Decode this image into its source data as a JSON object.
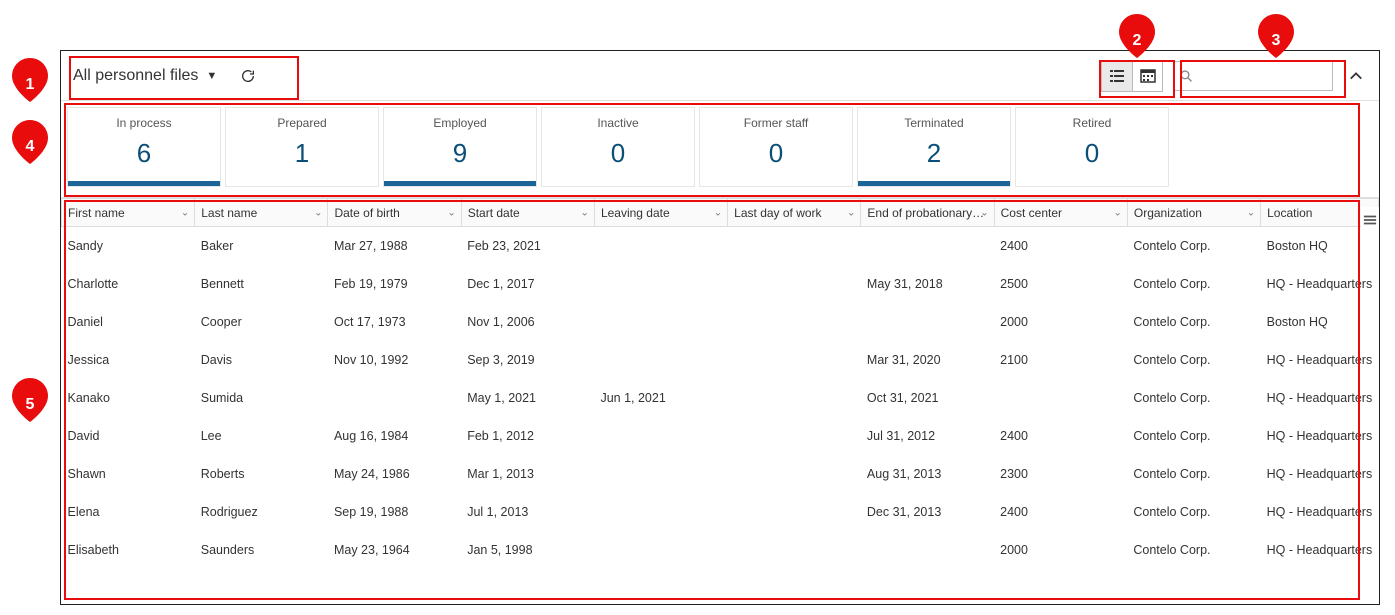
{
  "toolbar": {
    "filter_label": "All personnel files",
    "refresh_label": "Refresh",
    "search_placeholder": ""
  },
  "statuses": [
    {
      "label": "In process",
      "count": "6",
      "underline": "#1b6599"
    },
    {
      "label": "Prepared",
      "count": "1",
      "underline": "transparent"
    },
    {
      "label": "Employed",
      "count": "9",
      "underline": "#1b6599"
    },
    {
      "label": "Inactive",
      "count": "0",
      "underline": "transparent"
    },
    {
      "label": "Former staff",
      "count": "0",
      "underline": "transparent"
    },
    {
      "label": "Terminated",
      "count": "2",
      "underline": "#1b6599"
    },
    {
      "label": "Retired",
      "count": "0",
      "underline": "transparent"
    }
  ],
  "table": {
    "headers": {
      "first": "First name",
      "last": "Last name",
      "dob": "Date of birth",
      "start": "Start date",
      "leave": "Leaving date",
      "lastday": "Last day of work",
      "prob": "End of probationary…",
      "cost": "Cost center",
      "org": "Organization",
      "loc": "Location"
    },
    "rows": [
      {
        "first": "Sandy",
        "last": "Baker",
        "dob": "Mar 27, 1988",
        "start": "Feb 23, 2021",
        "leave": "",
        "lastday": "",
        "prob": "",
        "cost": "2400",
        "org": "Contelo Corp.",
        "loc": "Boston HQ"
      },
      {
        "first": "Charlotte",
        "last": "Bennett",
        "dob": "Feb 19, 1979",
        "start": "Dec 1, 2017",
        "leave": "",
        "lastday": "",
        "prob": "May 31, 2018",
        "cost": "2500",
        "org": "Contelo Corp.",
        "loc": "HQ - Headquarters"
      },
      {
        "first": "Daniel",
        "last": "Cooper",
        "dob": "Oct 17, 1973",
        "start": "Nov 1, 2006",
        "leave": "",
        "lastday": "",
        "prob": "",
        "cost": "2000",
        "org": "Contelo Corp.",
        "loc": "Boston HQ"
      },
      {
        "first": "Jessica",
        "last": "Davis",
        "dob": "Nov 10, 1992",
        "start": "Sep 3, 2019",
        "leave": "",
        "lastday": "",
        "prob": "Mar 31, 2020",
        "cost": "2100",
        "org": "Contelo Corp.",
        "loc": "HQ - Headquarters"
      },
      {
        "first": "Kanako",
        "last": "Sumida",
        "dob": "",
        "start": "May 1, 2021",
        "leave": "Jun 1, 2021",
        "lastday": "",
        "prob": "Oct 31, 2021",
        "cost": "",
        "org": "Contelo Corp.",
        "loc": "HQ - Headquarters"
      },
      {
        "first": "David",
        "last": "Lee",
        "dob": "Aug 16, 1984",
        "start": "Feb 1, 2012",
        "leave": "",
        "lastday": "",
        "prob": "Jul 31, 2012",
        "cost": "2400",
        "org": "Contelo Corp.",
        "loc": "HQ - Headquarters"
      },
      {
        "first": "Shawn",
        "last": "Roberts",
        "dob": "May 24, 1986",
        "start": "Mar 1, 2013",
        "leave": "",
        "lastday": "",
        "prob": "Aug 31, 2013",
        "cost": "2300",
        "org": "Contelo Corp.",
        "loc": "HQ - Headquarters"
      },
      {
        "first": "Elena",
        "last": "Rodriguez",
        "dob": "Sep 19, 1988",
        "start": "Jul 1, 2013",
        "leave": "",
        "lastday": "",
        "prob": "Dec 31, 2013",
        "cost": "2400",
        "org": "Contelo Corp.",
        "loc": "HQ - Headquarters"
      },
      {
        "first": "Elisabeth",
        "last": "Saunders",
        "dob": "May 23, 1964",
        "start": "Jan 5, 1998",
        "leave": "",
        "lastday": "",
        "prob": "",
        "cost": "2000",
        "org": "Contelo Corp.",
        "loc": "HQ - Headquarters"
      }
    ]
  },
  "callouts": {
    "1": "1",
    "2": "2",
    "3": "3",
    "4": "4",
    "5": "5"
  }
}
